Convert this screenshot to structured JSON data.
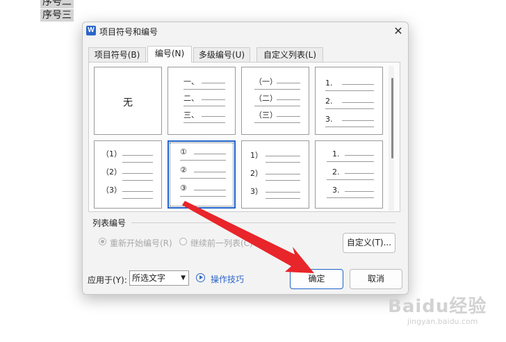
{
  "document": {
    "lines": [
      "序号二",
      "序号三"
    ]
  },
  "dialog": {
    "title": "项目符号和编号",
    "app_icon_letter": "W",
    "close_label": "✕",
    "tabs": [
      {
        "label": "项目符号(B)"
      },
      {
        "label": "编号(N)",
        "active": true
      },
      {
        "label": "多级编号(U)"
      },
      {
        "label": "自定义列表(L)"
      }
    ],
    "gallery": {
      "none_label": "无",
      "styles": [
        {
          "markers": [
            "一、",
            "二、",
            "三、"
          ]
        },
        {
          "markers": [
            "（一）",
            "（二）",
            "（三）"
          ]
        },
        {
          "markers": [
            "1.",
            "2.",
            "3."
          ]
        },
        {
          "markers": [
            "（1）",
            "（2）",
            "（3）"
          ]
        },
        {
          "markers": [
            "①",
            "②",
            "③"
          ],
          "selected": true
        },
        {
          "markers": [
            "1）",
            "2）",
            "3）"
          ]
        },
        {
          "markers": [
            "1.",
            "2.",
            "3."
          ]
        }
      ]
    },
    "list_numbering": {
      "title": "列表编号",
      "restart_label": "重新开始编号(R)",
      "continue_label": "继续前一列表(C)",
      "customize_label": "自定义(T)..."
    },
    "footer": {
      "apply_to_label": "应用于(Y):",
      "apply_to_value": "所选文字",
      "tips_label": "操作技巧",
      "ok_label": "确定",
      "cancel_label": "取消"
    }
  },
  "watermark": {
    "text": "Baidu经验",
    "url": "jingyan.baidu.com"
  },
  "colors": {
    "accent": "#1e63c9",
    "annotation_arrow": "#e8252a"
  }
}
